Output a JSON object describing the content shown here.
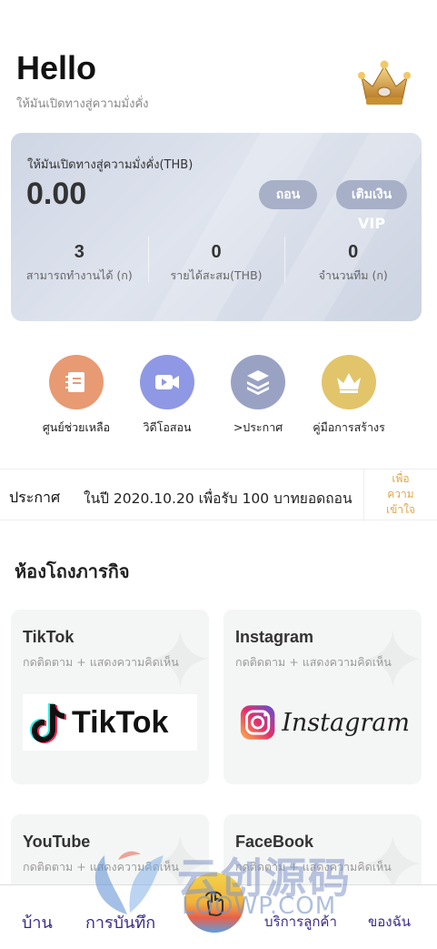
{
  "header": {
    "title": "Hello",
    "subtitle": "ให้มันเปิดทางสู่ความมั่งคั่ง",
    "crown_icon": "crown-icon"
  },
  "wallet": {
    "label": "ให้มันเปิดทางสู่ความมั่งคั่ง(THB)",
    "amount": "0.00",
    "withdraw_label": "ถอน",
    "topup_label": "เติมเงิน",
    "vip_label": "VIP",
    "stats": [
      {
        "value": "3",
        "label": "สามารถทำงานได้ (ก)"
      },
      {
        "value": "0",
        "label": "รายได้สะสม(THB)"
      },
      {
        "value": "0",
        "label": "จำนวนทีม (ก)"
      }
    ]
  },
  "quick_links": [
    {
      "label": "ศูนย์ช่วยเหลือ",
      "icon": "notebook-icon",
      "color": "#e89a73"
    },
    {
      "label": "วิดีโอสอน",
      "icon": "video-icon",
      "color": "#8f98e4"
    },
    {
      "label": ">ประกาศ",
      "icon": "books-icon",
      "color": "#9aa2c4"
    },
    {
      "label": "คู่มือการสร้างร",
      "icon": "crown-icon",
      "color": "#e2c46a"
    }
  ],
  "notice": {
    "title": "ประกาศ",
    "text": "ในปี 2020.10.20 เพื่อรับ 100 บาทยอดถอน",
    "button_lines": [
      "เพื่อ",
      "ความ",
      "เข้าใจ"
    ]
  },
  "section_title": "ห้องโถงภารกิจ",
  "tasks": [
    {
      "name": "TikTok",
      "desc": "กดติดตาม + แสดงความคิดเห็น",
      "logo_text": "TikTok"
    },
    {
      "name": "Instagram",
      "desc": "กดติดตาม + แสดงความคิดเห็น",
      "logo_text": "Instagram"
    },
    {
      "name": "YouTube",
      "desc": "กดติดตาม + แสดงความคิดเห็น"
    },
    {
      "name": "FaceBook",
      "desc": "กดติดตาม + แสดงความคิดเห็น"
    }
  ],
  "watermark": {
    "cn": "云创源码",
    "en": "LOOWP.COM"
  },
  "tabbar": {
    "home": "บ้าน",
    "records": "การบันทึก",
    "service": "บริการลูกค้า",
    "mine": "ของฉัน"
  },
  "colors": {
    "accent": "#3a2a8a",
    "notice_button": "#e2a54a",
    "pill": "#a7b0c7"
  }
}
